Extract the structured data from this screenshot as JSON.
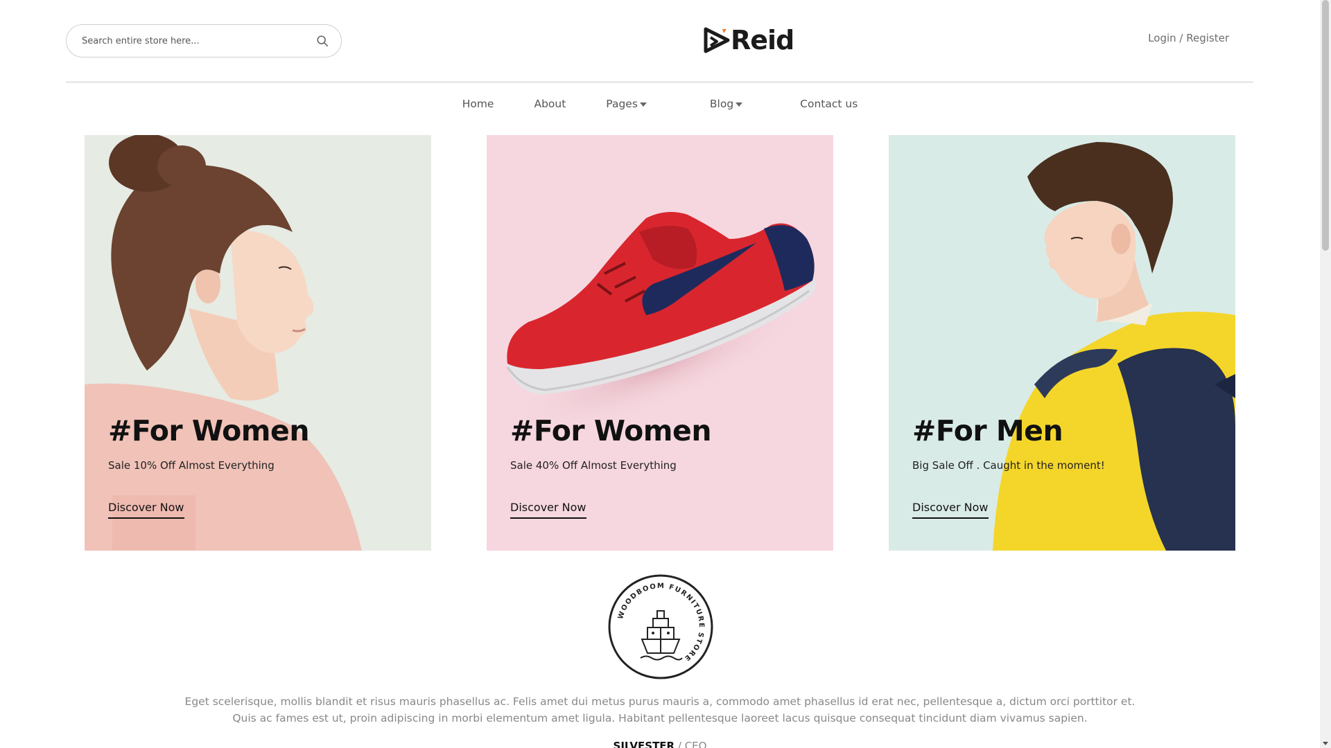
{
  "header": {
    "search": {
      "placeholder": "Search entire store here...",
      "icon": "search-icon"
    },
    "logo": {
      "text": "Reid",
      "icon": "play-logo-icon"
    },
    "account": {
      "login": "Login",
      "separator": " / ",
      "register": "Register"
    }
  },
  "nav": {
    "items": [
      {
        "label": "Home",
        "dropdown": false
      },
      {
        "label": "About",
        "dropdown": false
      },
      {
        "label": "Pages",
        "dropdown": true
      },
      {
        "label": "Blog",
        "dropdown": true
      },
      {
        "label": "Contact us",
        "dropdown": false
      }
    ]
  },
  "banners": [
    {
      "title": "#For Women",
      "subtitle": "Sale 10% Off Almost Everything",
      "cta": "Discover Now",
      "background": "#e6ebe3",
      "image": "woman-portrait"
    },
    {
      "title": "#For Women",
      "subtitle": "Sale 40% Off Almost Everything",
      "cta": "Discover Now",
      "background": "#f6d7df",
      "image": "red-sneaker"
    },
    {
      "title": "#For Men",
      "subtitle": "Big Sale Off . Caught in the moment!",
      "cta": "Discover Now",
      "background": "#d9ebe7",
      "image": "man-with-backpack"
    }
  ],
  "testimonial": {
    "badge_text": "WOODBOOM FURNITURE STORE",
    "quote_line1": "Eget scelerisque, mollis blandit et risus mauris phasellus ac. Felis amet dui metus purus mauris a, commodo amet phasellus id erat nec, pellentesque a, dictum orci porttitor et.",
    "quote_line2": "Quis ac fames est ut, proin adipiscing in morbi elementum amet ligula. Habitant pellentesque laoreet lacus quisque consequat tincidunt diam vivamus sapien.",
    "author_name": "SILVESTER",
    "author_separator": " / ",
    "author_role": "CEO"
  },
  "colors": {
    "text_dark": "#111111",
    "text_muted": "#888888",
    "nav_text": "#555555"
  }
}
